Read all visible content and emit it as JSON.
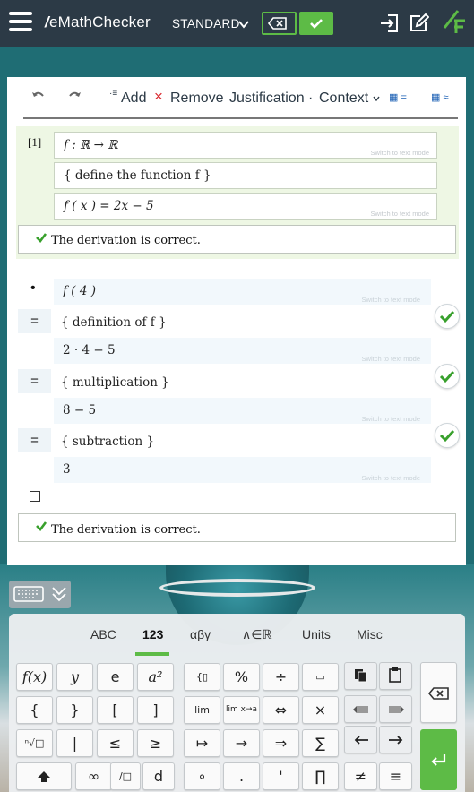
{
  "app": {
    "logo_text": "eMathChecker",
    "mode_label": "STANDARD"
  },
  "toolbar": {
    "add_label": "Add",
    "remove_label": "Remove",
    "justification_label": "Justification ·",
    "context_label": "Context",
    "calc_eq_label": "=",
    "calc_approx_label": "≈"
  },
  "definition": {
    "line_number": "[1]",
    "signature": "f : ℝ → ℝ",
    "justification": "{  define the function  f  }",
    "body": "f ( x )  =  2x − 5",
    "hint": "Switch to text mode",
    "result": "The derivation is correct."
  },
  "derivation": {
    "bullet": "•",
    "start_expr": "f ( 4 )",
    "steps": [
      {
        "op": "=",
        "hint_text": "{  definition of  f  }",
        "expr": "2 · 4 − 5"
      },
      {
        "op": "=",
        "hint_text": "{  multiplication  }",
        "expr": "8 − 5"
      },
      {
        "op": "=",
        "hint_text": "{  subtraction  }",
        "expr": "3"
      }
    ],
    "hint": "Switch to text mode",
    "result": "The derivation is correct."
  },
  "keyboard": {
    "tabs": [
      "ABC",
      "123",
      "αβγ",
      "∧∈ℝ",
      "Units",
      "Misc"
    ],
    "active_tab": "123",
    "row1": [
      "f(x)",
      "y",
      "e",
      "a²"
    ],
    "row2": [
      "{",
      "}",
      "[",
      "]"
    ],
    "row3": [
      "ⁿ√□",
      "|",
      "≤",
      "≥"
    ],
    "row4": [
      "∞",
      "/□",
      "d"
    ],
    "mid_row1": [
      "{▯",
      "%",
      "÷",
      "▭"
    ],
    "mid_row2": [
      "lim",
      "lim x→a",
      "⇔",
      "×"
    ],
    "mid_row3": [
      "↦",
      "→",
      "⇒",
      "∑"
    ],
    "mid_row4": [
      "∘",
      ".",
      "'",
      "∏"
    ],
    "right_row4": [
      "≠",
      "≡"
    ]
  },
  "colors": {
    "accent_green": "#5dbb46",
    "topbar": "#2c3a46",
    "definition_bg": "#eef7e4",
    "derivation_row_bg": "#f2f8fc"
  }
}
